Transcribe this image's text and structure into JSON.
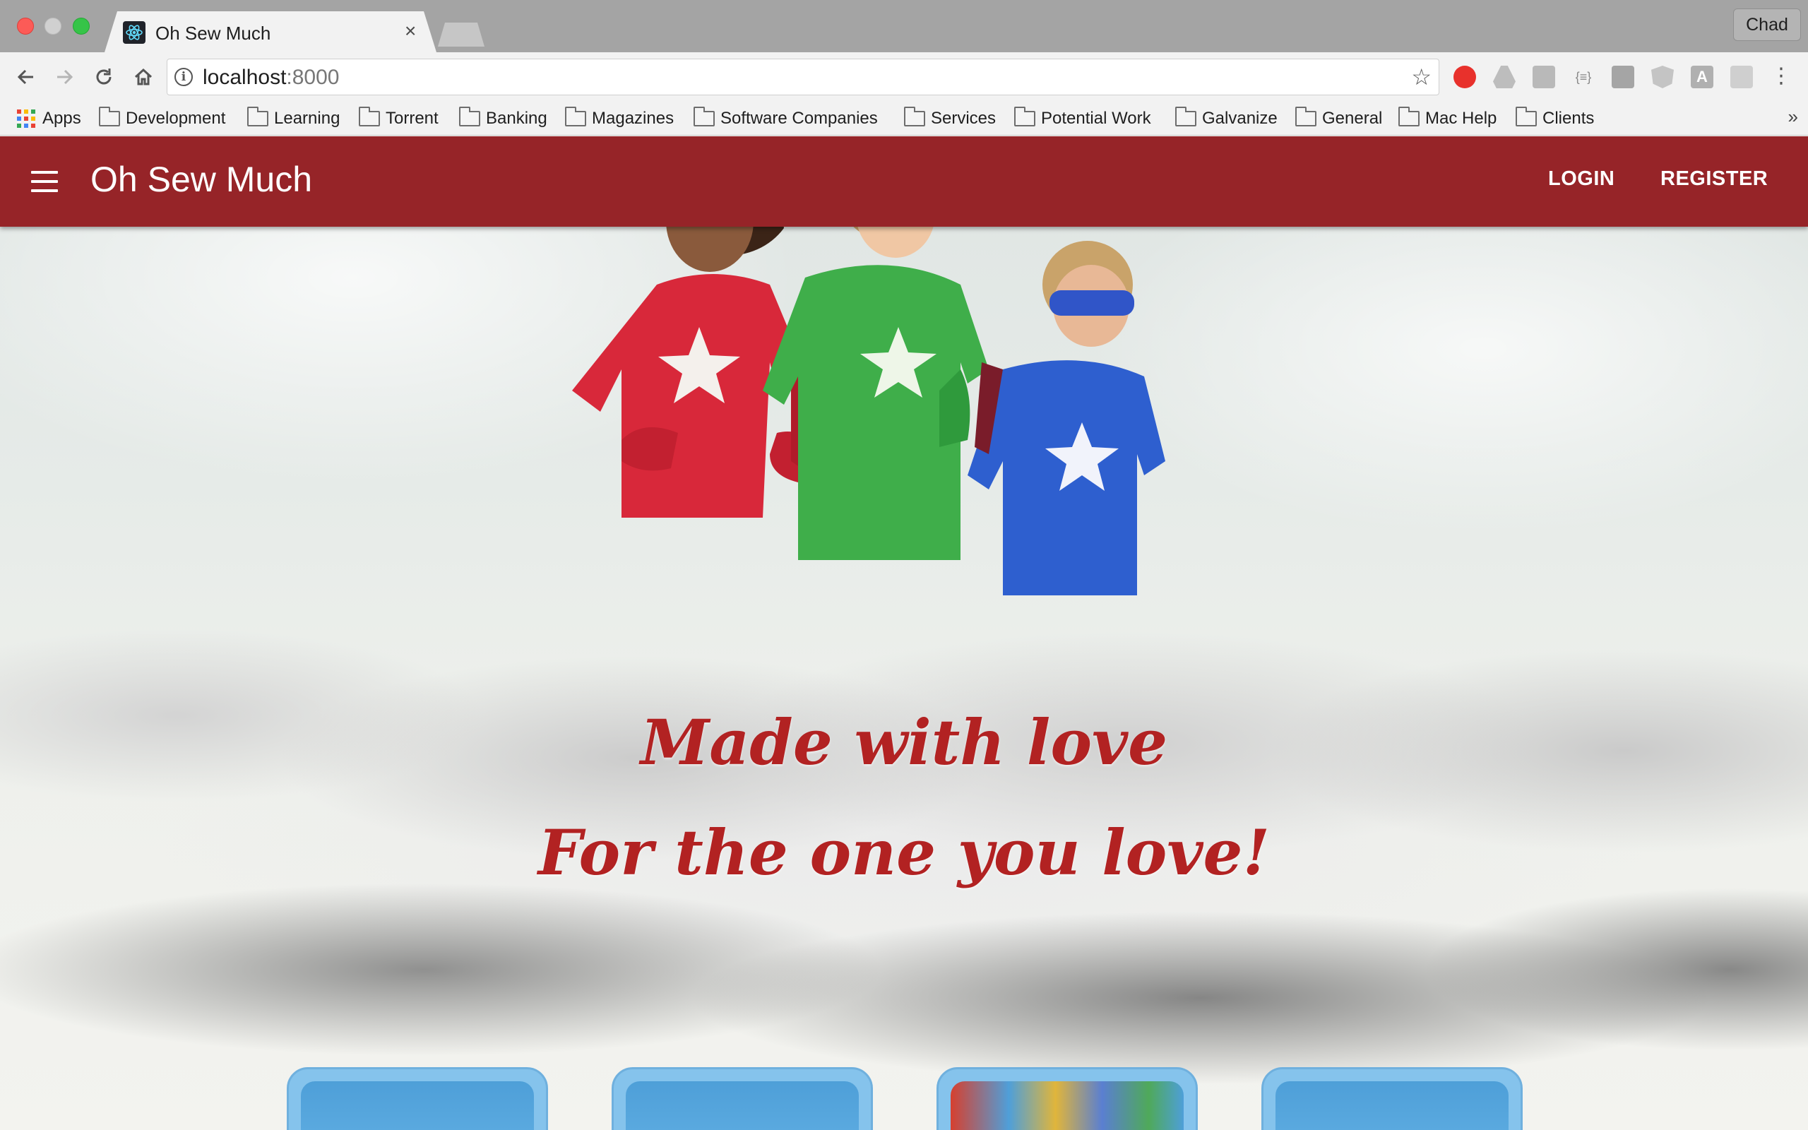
{
  "browser": {
    "tab_title": "Oh Sew Much",
    "tab_close": "×",
    "profile_name": "Chad",
    "url_host": "localhost",
    "url_port": ":8000",
    "bookmarks": [
      "Apps",
      "Development",
      "Learning",
      "Torrent",
      "Banking",
      "Magazines",
      "Software Companies",
      "Services",
      "Potential Work",
      "Galvanize",
      "General",
      "Mac Help",
      "Clients"
    ],
    "bookmarks_more": "»"
  },
  "appbar": {
    "title": "Oh Sew Much",
    "login": "LOGIN",
    "register": "REGISTER",
    "color": "#962428"
  },
  "hero": {
    "line1": "Made with love",
    "line2": "For the one you love!",
    "tagline_color": "#b22222"
  },
  "cards": [
    {
      "name": "category-card-1"
    },
    {
      "name": "category-card-2"
    },
    {
      "name": "category-card-3"
    },
    {
      "name": "category-card-4"
    }
  ]
}
